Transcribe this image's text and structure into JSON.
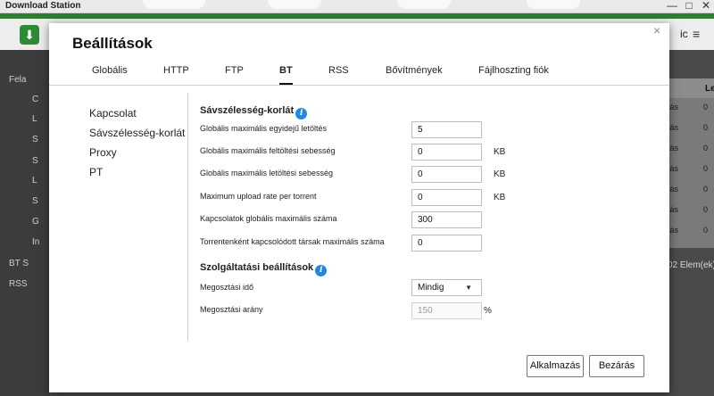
{
  "window": {
    "title": "Download Station",
    "minimize": "—",
    "maximize": "□",
    "close": "✕"
  },
  "app_bar": {
    "logo_icon": "download-arrow-icon",
    "partial_text": "ic",
    "menu": "≡"
  },
  "sidebar": {
    "items": [
      {
        "label": "Fela"
      },
      {
        "label": "C"
      },
      {
        "label": "L"
      },
      {
        "label": "S"
      },
      {
        "label": "S"
      },
      {
        "label": "L"
      },
      {
        "label": "S"
      },
      {
        "label": "G"
      },
      {
        "label": "In"
      },
      {
        "label": "BT S"
      },
      {
        "label": "RSS"
      }
    ]
  },
  "bg_table": {
    "header": "Le",
    "rows": [
      {
        "c1": "tás",
        "c2": "0"
      },
      {
        "c1": "tás",
        "c2": "0"
      },
      {
        "c1": "tás",
        "c2": "0"
      },
      {
        "c1": "tás",
        "c2": "0"
      },
      {
        "c1": "tás",
        "c2": "0"
      },
      {
        "c1": "tás",
        "c2": "0"
      },
      {
        "c1": "tás",
        "c2": "0"
      }
    ],
    "count": "02 Elem(ek)"
  },
  "dialog": {
    "title": "Beállítások",
    "close": "×",
    "tabs": [
      {
        "label": "Globális"
      },
      {
        "label": "HTTP"
      },
      {
        "label": "FTP"
      },
      {
        "label": "BT"
      },
      {
        "label": "RSS"
      },
      {
        "label": "Bővítmények"
      },
      {
        "label": "Fájlhoszting fiók"
      }
    ],
    "nav": [
      {
        "label": "Kapcsolat"
      },
      {
        "label": "Sávszélesség-korlát"
      },
      {
        "label": "Proxy"
      },
      {
        "label": "PT"
      }
    ],
    "bandwidth": {
      "title": "Sávszélesség-korlát",
      "rows": [
        {
          "label": "Globális maximális egyidejű letöltés",
          "value": "5",
          "unit": ""
        },
        {
          "label": "Globális maximális feltöltési sebesség",
          "value": "0",
          "unit": "KB"
        },
        {
          "label": "Globális maximális letöltési sebesség",
          "value": "0",
          "unit": "KB"
        },
        {
          "label": "Maximum upload rate per torrent",
          "value": "0",
          "unit": "KB"
        },
        {
          "label": "Kapcsolatok globális maximális száma",
          "value": "300",
          "unit": ""
        },
        {
          "label": "Torrentenként kapcsolódott társak maximális száma",
          "value": "0",
          "unit": ""
        }
      ]
    },
    "service": {
      "title": "Szolgáltatási beállítások",
      "share_time_label": "Megosztási idő",
      "share_time_value": "Mindig",
      "share_ratio_label": "Megosztási arány",
      "share_ratio_value": "150",
      "share_ratio_unit": "%"
    },
    "buttons": {
      "apply": "Alkalmazás",
      "close": "Bezárás"
    }
  }
}
